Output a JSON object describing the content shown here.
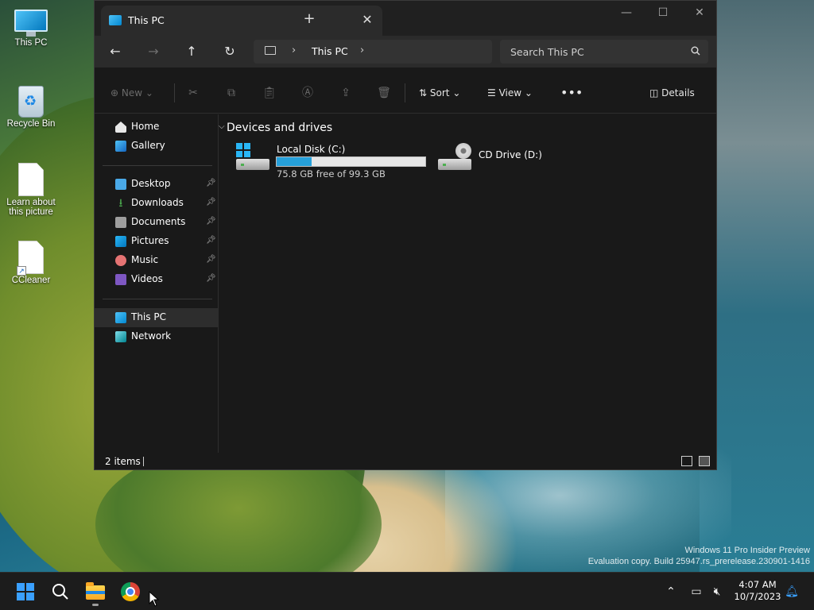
{
  "desktop": {
    "icons": [
      {
        "label": "This PC"
      },
      {
        "label": "Recycle Bin"
      },
      {
        "label": "Learn about this picture"
      },
      {
        "label": "CCleaner"
      }
    ],
    "watermark_line1": "Windows 11 Pro Insider Preview",
    "watermark_line2": "Evaluation copy. Build 25947.rs_prerelease.230901-1416"
  },
  "explorer": {
    "tab_title": "This PC",
    "address_crumb": "This PC",
    "search_placeholder": "Search This PC",
    "commands": {
      "new": "New",
      "sort": "Sort",
      "view": "View",
      "details": "Details"
    },
    "sidebar": {
      "top": [
        {
          "label": "Home",
          "icon": "home-icon"
        },
        {
          "label": "Gallery",
          "icon": "gallery-icon"
        }
      ],
      "pinned": [
        {
          "label": "Desktop",
          "icon": "desktop-folder-icon"
        },
        {
          "label": "Downloads",
          "icon": "downloads-icon"
        },
        {
          "label": "Documents",
          "icon": "documents-icon"
        },
        {
          "label": "Pictures",
          "icon": "pictures-icon"
        },
        {
          "label": "Music",
          "icon": "music-icon"
        },
        {
          "label": "Videos",
          "icon": "videos-icon"
        }
      ],
      "bottom": [
        {
          "label": "This PC",
          "icon": "this-pc-icon"
        },
        {
          "label": "Network",
          "icon": "network-icon"
        }
      ]
    },
    "group_header": "Devices and drives",
    "drives": [
      {
        "name": "Local Disk (C:)",
        "free_text": "75.8 GB free of 99.3 GB",
        "used_fraction": 0.237
      },
      {
        "name": "CD Drive (D:)"
      }
    ],
    "status": "2 items"
  },
  "taskbar": {
    "time": "4:07 AM",
    "date": "10/7/2023"
  },
  "colors": {
    "accent": "#26a0da",
    "window_bg": "#191919",
    "titlebar_bg": "#202020",
    "taskbar_bg": "#1c1c1c"
  }
}
